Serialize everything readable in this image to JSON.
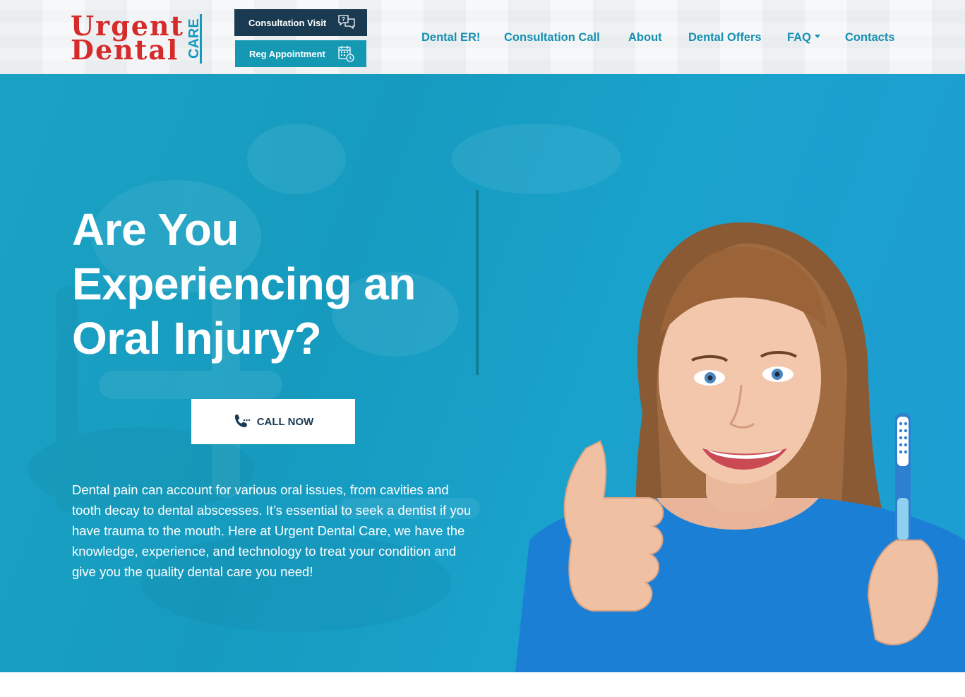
{
  "header": {
    "logo": {
      "word1": "Urgent",
      "word2": "Dental",
      "word3": "CARE"
    },
    "buttons": {
      "visit": {
        "label": "Consultation Visit",
        "icon": "chat-question-icon"
      },
      "appointment": {
        "label": "Reg Appointment",
        "icon": "calendar-clock-icon"
      }
    },
    "nav": [
      {
        "label": "Dental ER!"
      },
      {
        "label": "Consultation Call"
      },
      {
        "label": "About"
      },
      {
        "label": "Dental Offers"
      },
      {
        "label": "FAQ",
        "has_dropdown": true
      },
      {
        "label": "Contacts"
      }
    ]
  },
  "hero": {
    "title": "Are You Experiencing an Oral Injury?",
    "call_button": {
      "label": "CALL NOW",
      "icon": "phone-ringing-icon"
    },
    "body": "Dental pain can account for various oral issues, from cavities and tooth decay to dental abscesses. It’s essential to seek a dentist if you have trauma to the mouth. Here at Urgent Dental Care, we have the knowledge, experience, and technology to treat your condition and give you the quality dental care you need!"
  },
  "colors": {
    "brand_red": "#d62b2b",
    "brand_teal": "#1599b3",
    "navy": "#1a3a52",
    "nav_text": "#1590b0",
    "hero_bg": "#18a0c6"
  }
}
